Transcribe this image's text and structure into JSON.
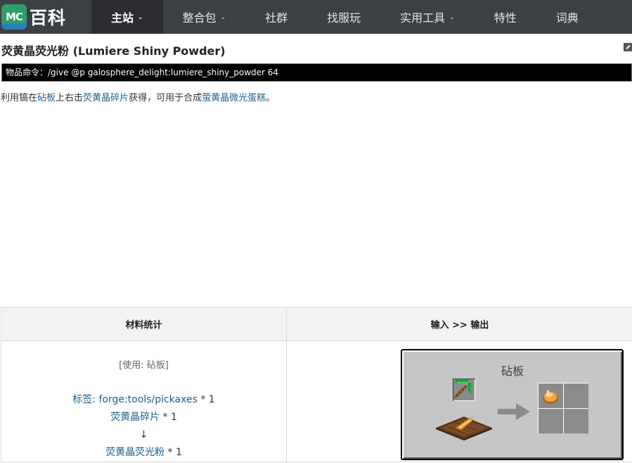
{
  "nav": {
    "logo_mc": "MC",
    "logo_text": "百科",
    "items": [
      {
        "label": "主站",
        "dropdown": true,
        "active": true
      },
      {
        "label": "整合包",
        "dropdown": true,
        "active": false
      },
      {
        "label": "社群",
        "dropdown": false,
        "active": false
      },
      {
        "label": "找服玩",
        "dropdown": false,
        "active": false
      },
      {
        "label": "实用工具",
        "dropdown": true,
        "active": false
      },
      {
        "label": "特性",
        "dropdown": false,
        "active": false
      },
      {
        "label": "词典",
        "dropdown": false,
        "active": false
      }
    ]
  },
  "page": {
    "title": "荧黄晶荧光粉 (Lumiere Shiny Powder)",
    "command_label": "物品命令：",
    "command_value": "/give @p galosphere_delight:lumiere_shiny_powder 64"
  },
  "desc": {
    "p1": "利用镐在",
    "link1": "砧板",
    "p2": "上右击",
    "link2": "荧黄晶碎片",
    "p3": "获得，可用于合成",
    "link3": "萤黄晶微光蛋糕",
    "p4": "。"
  },
  "recipe": {
    "col1_header": "材料统计",
    "col2_header": "输入 >> 输出",
    "using": "[使用: 砧板]",
    "materials": [
      {
        "name": "标签: forge:tools/pickaxes",
        "qty": " * 1"
      },
      {
        "name": "荧黄晶碎片",
        "qty": " * 1"
      }
    ],
    "down_arrow": "↓",
    "result": {
      "name": "荧黄晶荧光粉",
      "qty": " * 1"
    },
    "gui_title": "砧板"
  },
  "colors": {
    "nav_bg": "#3c3f44",
    "nav_active": "#2b2d31",
    "link": "#1f5f8b",
    "gui_bg": "#c6c6c6",
    "slot": "#8b8b8b"
  },
  "icons": [
    "chevron-down-icon",
    "edit-icon",
    "pickaxe-icon",
    "cutting-board-icon",
    "powder-icon",
    "arrow-right-icon"
  ]
}
